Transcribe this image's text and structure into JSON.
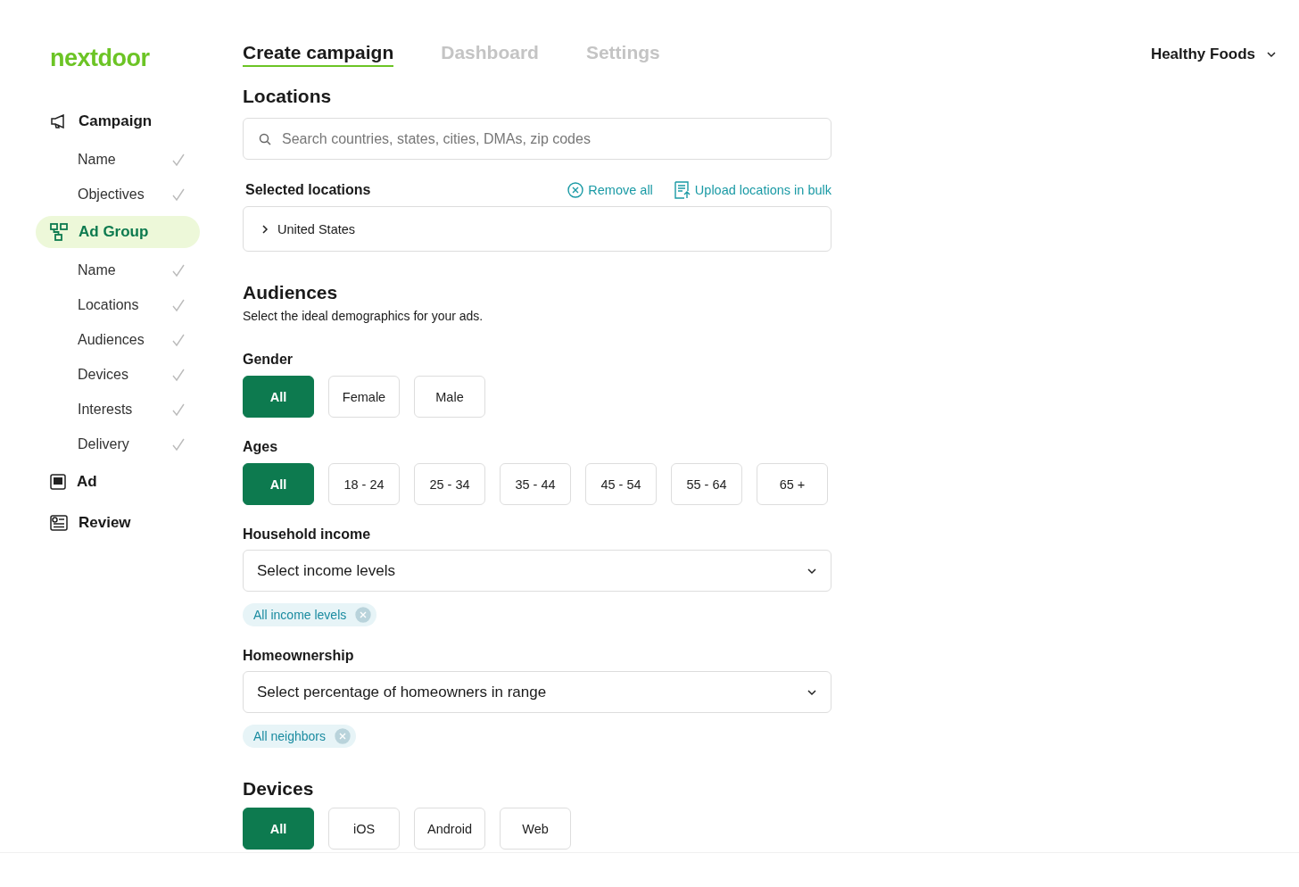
{
  "logo": "nextdoor",
  "tabs": [
    {
      "label": "Create campaign",
      "selected": true
    },
    {
      "label": "Dashboard",
      "selected": false
    },
    {
      "label": "Settings",
      "selected": false
    }
  ],
  "account": {
    "name": "Healthy Foods"
  },
  "sidebar": {
    "sections": [
      {
        "label": "Campaign",
        "selected": false,
        "children": [
          {
            "label": "Name",
            "checked": true
          },
          {
            "label": "Objectives",
            "checked": true
          }
        ]
      },
      {
        "label": "Ad Group",
        "selected": true,
        "children": [
          {
            "label": "Name",
            "checked": true
          },
          {
            "label": "Locations",
            "checked": true
          },
          {
            "label": "Audiences",
            "checked": true
          },
          {
            "label": "Devices",
            "checked": true
          },
          {
            "label": "Interests",
            "checked": true
          },
          {
            "label": "Delivery",
            "checked": true
          }
        ]
      },
      {
        "label": "Ad",
        "selected": false
      },
      {
        "label": "Review",
        "selected": false
      }
    ]
  },
  "locations": {
    "title": "Locations",
    "search": {
      "placeholder": "Search countries, states, cities, DMAs, zip codes"
    },
    "selected_title": "Selected locations",
    "actions": [
      {
        "label": "Remove all"
      },
      {
        "label": "Upload locations in bulk"
      }
    ],
    "items": [
      {
        "label": "United States",
        "expanded": false
      }
    ]
  },
  "audiences": {
    "title": "Audiences",
    "subtitle": "Select the ideal demographics for your ads.",
    "groups": [
      {
        "kind": "options",
        "label": "Gender",
        "options": [
          {
            "label": "All",
            "selected": true
          },
          {
            "label": "Female",
            "selected": false
          },
          {
            "label": "Male",
            "selected": false
          }
        ]
      },
      {
        "kind": "options",
        "label": "Ages",
        "options": [
          {
            "label": "All",
            "selected": true
          },
          {
            "label": "18 - 24",
            "selected": false
          },
          {
            "label": "25 - 34",
            "selected": false
          },
          {
            "label": "35 - 44",
            "selected": false
          },
          {
            "label": "45 - 54",
            "selected": false
          },
          {
            "label": "55 - 64",
            "selected": false
          },
          {
            "label": "65 +",
            "selected": false
          }
        ]
      },
      {
        "kind": "select",
        "label": "Household income",
        "placeholder": "Select income levels",
        "chips": [
          "All income levels"
        ]
      },
      {
        "kind": "select",
        "label": "Homeownership",
        "placeholder": "Select percentage of homeowners in range",
        "chips": [
          "All neighbors"
        ]
      }
    ]
  },
  "devices": {
    "title": "Devices",
    "options": [
      {
        "label": "All",
        "selected": true
      },
      {
        "label": "iOS",
        "selected": false
      },
      {
        "label": "Android",
        "selected": false
      },
      {
        "label": "Web",
        "selected": false
      }
    ]
  }
}
